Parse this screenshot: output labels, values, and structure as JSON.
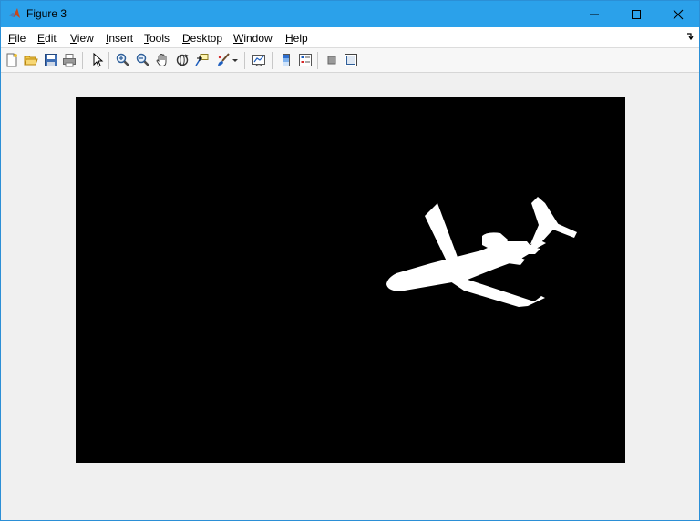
{
  "window": {
    "title": "Figure 3",
    "controls": [
      "minimize",
      "maximize",
      "close"
    ]
  },
  "menu": {
    "items": [
      "File",
      "Edit",
      "View",
      "Insert",
      "Tools",
      "Desktop",
      "Window",
      "Help"
    ]
  },
  "toolbar": {
    "buttons": [
      "new-figure-icon",
      "open-file-icon",
      "save-icon",
      "print-icon",
      "edit-plot-arrow-icon",
      "zoom-in-icon",
      "zoom-out-icon",
      "pan-hand-icon",
      "rotate-3d-icon",
      "data-cursor-icon",
      "brush-icon",
      "brush-dropdown-icon",
      "link-plot-icon",
      "insert-colorbar-icon",
      "insert-legend-icon",
      "hide-plot-tools-icon",
      "show-plot-tools-icon"
    ]
  },
  "image": {
    "background_color": "#000000",
    "foreground_color": "#ffffff",
    "content": "binary-mask-airplane"
  },
  "colors": {
    "titlebar": "#2ba1ea",
    "figure_background": "#f0f0f0"
  }
}
